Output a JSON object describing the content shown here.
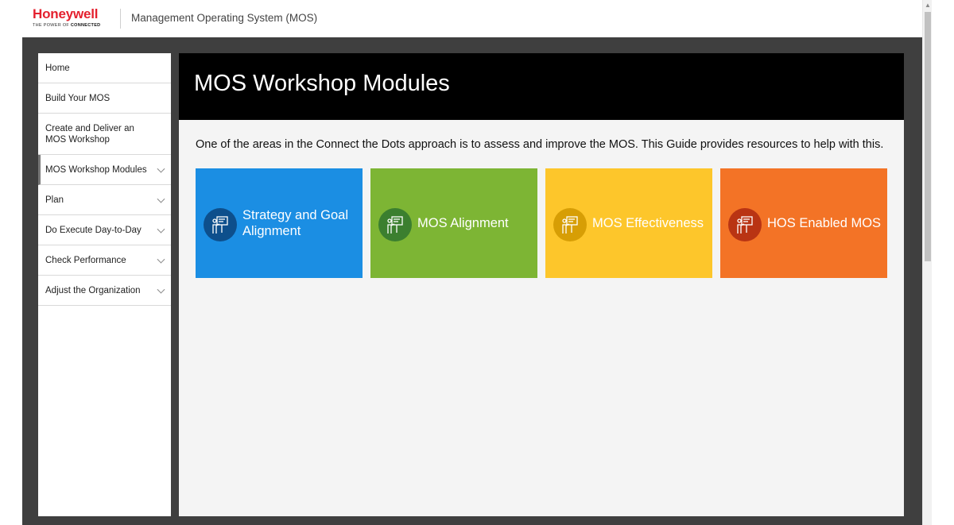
{
  "header": {
    "brand": "Honeywell",
    "tagline_prefix": "THE POWER OF ",
    "tagline_strong": "CONNECTED",
    "app_title": "Management Operating System (MOS)"
  },
  "sidebar": {
    "items": [
      {
        "label": "Home"
      },
      {
        "label": "Build Your MOS"
      },
      {
        "label": "Create and Deliver an MOS Workshop"
      },
      {
        "label": "MOS Workshop Modules"
      },
      {
        "label": "Plan"
      },
      {
        "label": "Do Execute Day-to-Day"
      },
      {
        "label": "Check Performance"
      },
      {
        "label": "Adjust the Organization"
      }
    ]
  },
  "main": {
    "title": "MOS Workshop Modules",
    "intro": "One of the areas in the Connect the Dots approach is to assess and improve the MOS. This Guide provides resources to help with this.",
    "tiles": [
      {
        "label": "Strategy and Goal Alignment",
        "color": "#1b8ee3",
        "icon_bg": "#0d4f8c",
        "icon": "presenter-board-icon"
      },
      {
        "label": "MOS Alignment",
        "color": "#7db534",
        "icon_bg": "#3b7f2f",
        "icon": "presenter-board-icon"
      },
      {
        "label": "MOS Effectiveness",
        "color": "#fdc62b",
        "icon_bg": "#d79e05",
        "icon": "presenter-board-icon"
      },
      {
        "label": "HOS Enabled MOS",
        "color": "#f37326",
        "icon_bg": "#b93413",
        "icon": "presenter-board-icon"
      }
    ]
  },
  "colors": {
    "brand_red": "#e4202e",
    "frame": "#3f3f3f",
    "banner": "#000000",
    "content_bg": "#f4f4f4"
  }
}
